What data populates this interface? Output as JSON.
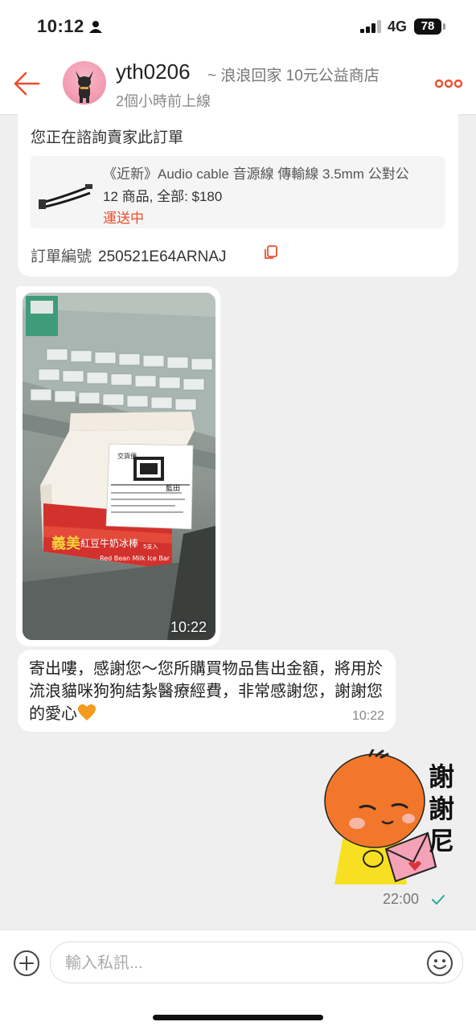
{
  "status_bar": {
    "time": "10:12",
    "network": "4G",
    "battery": "78"
  },
  "header": {
    "name": "yth0206",
    "shop": "~ 浪浪回家 10元公益商店",
    "last_seen": "2個小時前上線",
    "icons": {
      "back": "back-arrow-icon",
      "more": "more-icon"
    },
    "accent": "#ee4d2d"
  },
  "order_card": {
    "title": "您正在諮詢賣家此訂單",
    "product_name": "《近新》Audio cable 音源線 傳輸線 3.5mm 公對公",
    "quantity_total": "12 商品, 全部: $180",
    "shipping_status": "運送中",
    "order_no_label": "訂單編號",
    "order_no": "250521E64ARNAJ"
  },
  "messages": [
    {
      "type": "image",
      "time": "10:22"
    },
    {
      "type": "text",
      "text": "寄出嘍，感謝您～您所購買物品售出金額，將用於流浪貓咪狗狗結紮醫療經費，非常感謝您，謝謝您的愛心",
      "time": "10:22"
    },
    {
      "type": "sticker",
      "caption": "謝謝尼",
      "time": "22:00"
    }
  ],
  "input_bar": {
    "placeholder": "輸入私訊..."
  },
  "photo_content": {
    "package_labels": {
      "brand": "義美",
      "product": "紅豆牛奶冰棒",
      "product_en": "Red Bean Milk Ice Bar",
      "pieces": "5支入",
      "slip_title": "交貨便",
      "recipient": "藍田"
    }
  }
}
